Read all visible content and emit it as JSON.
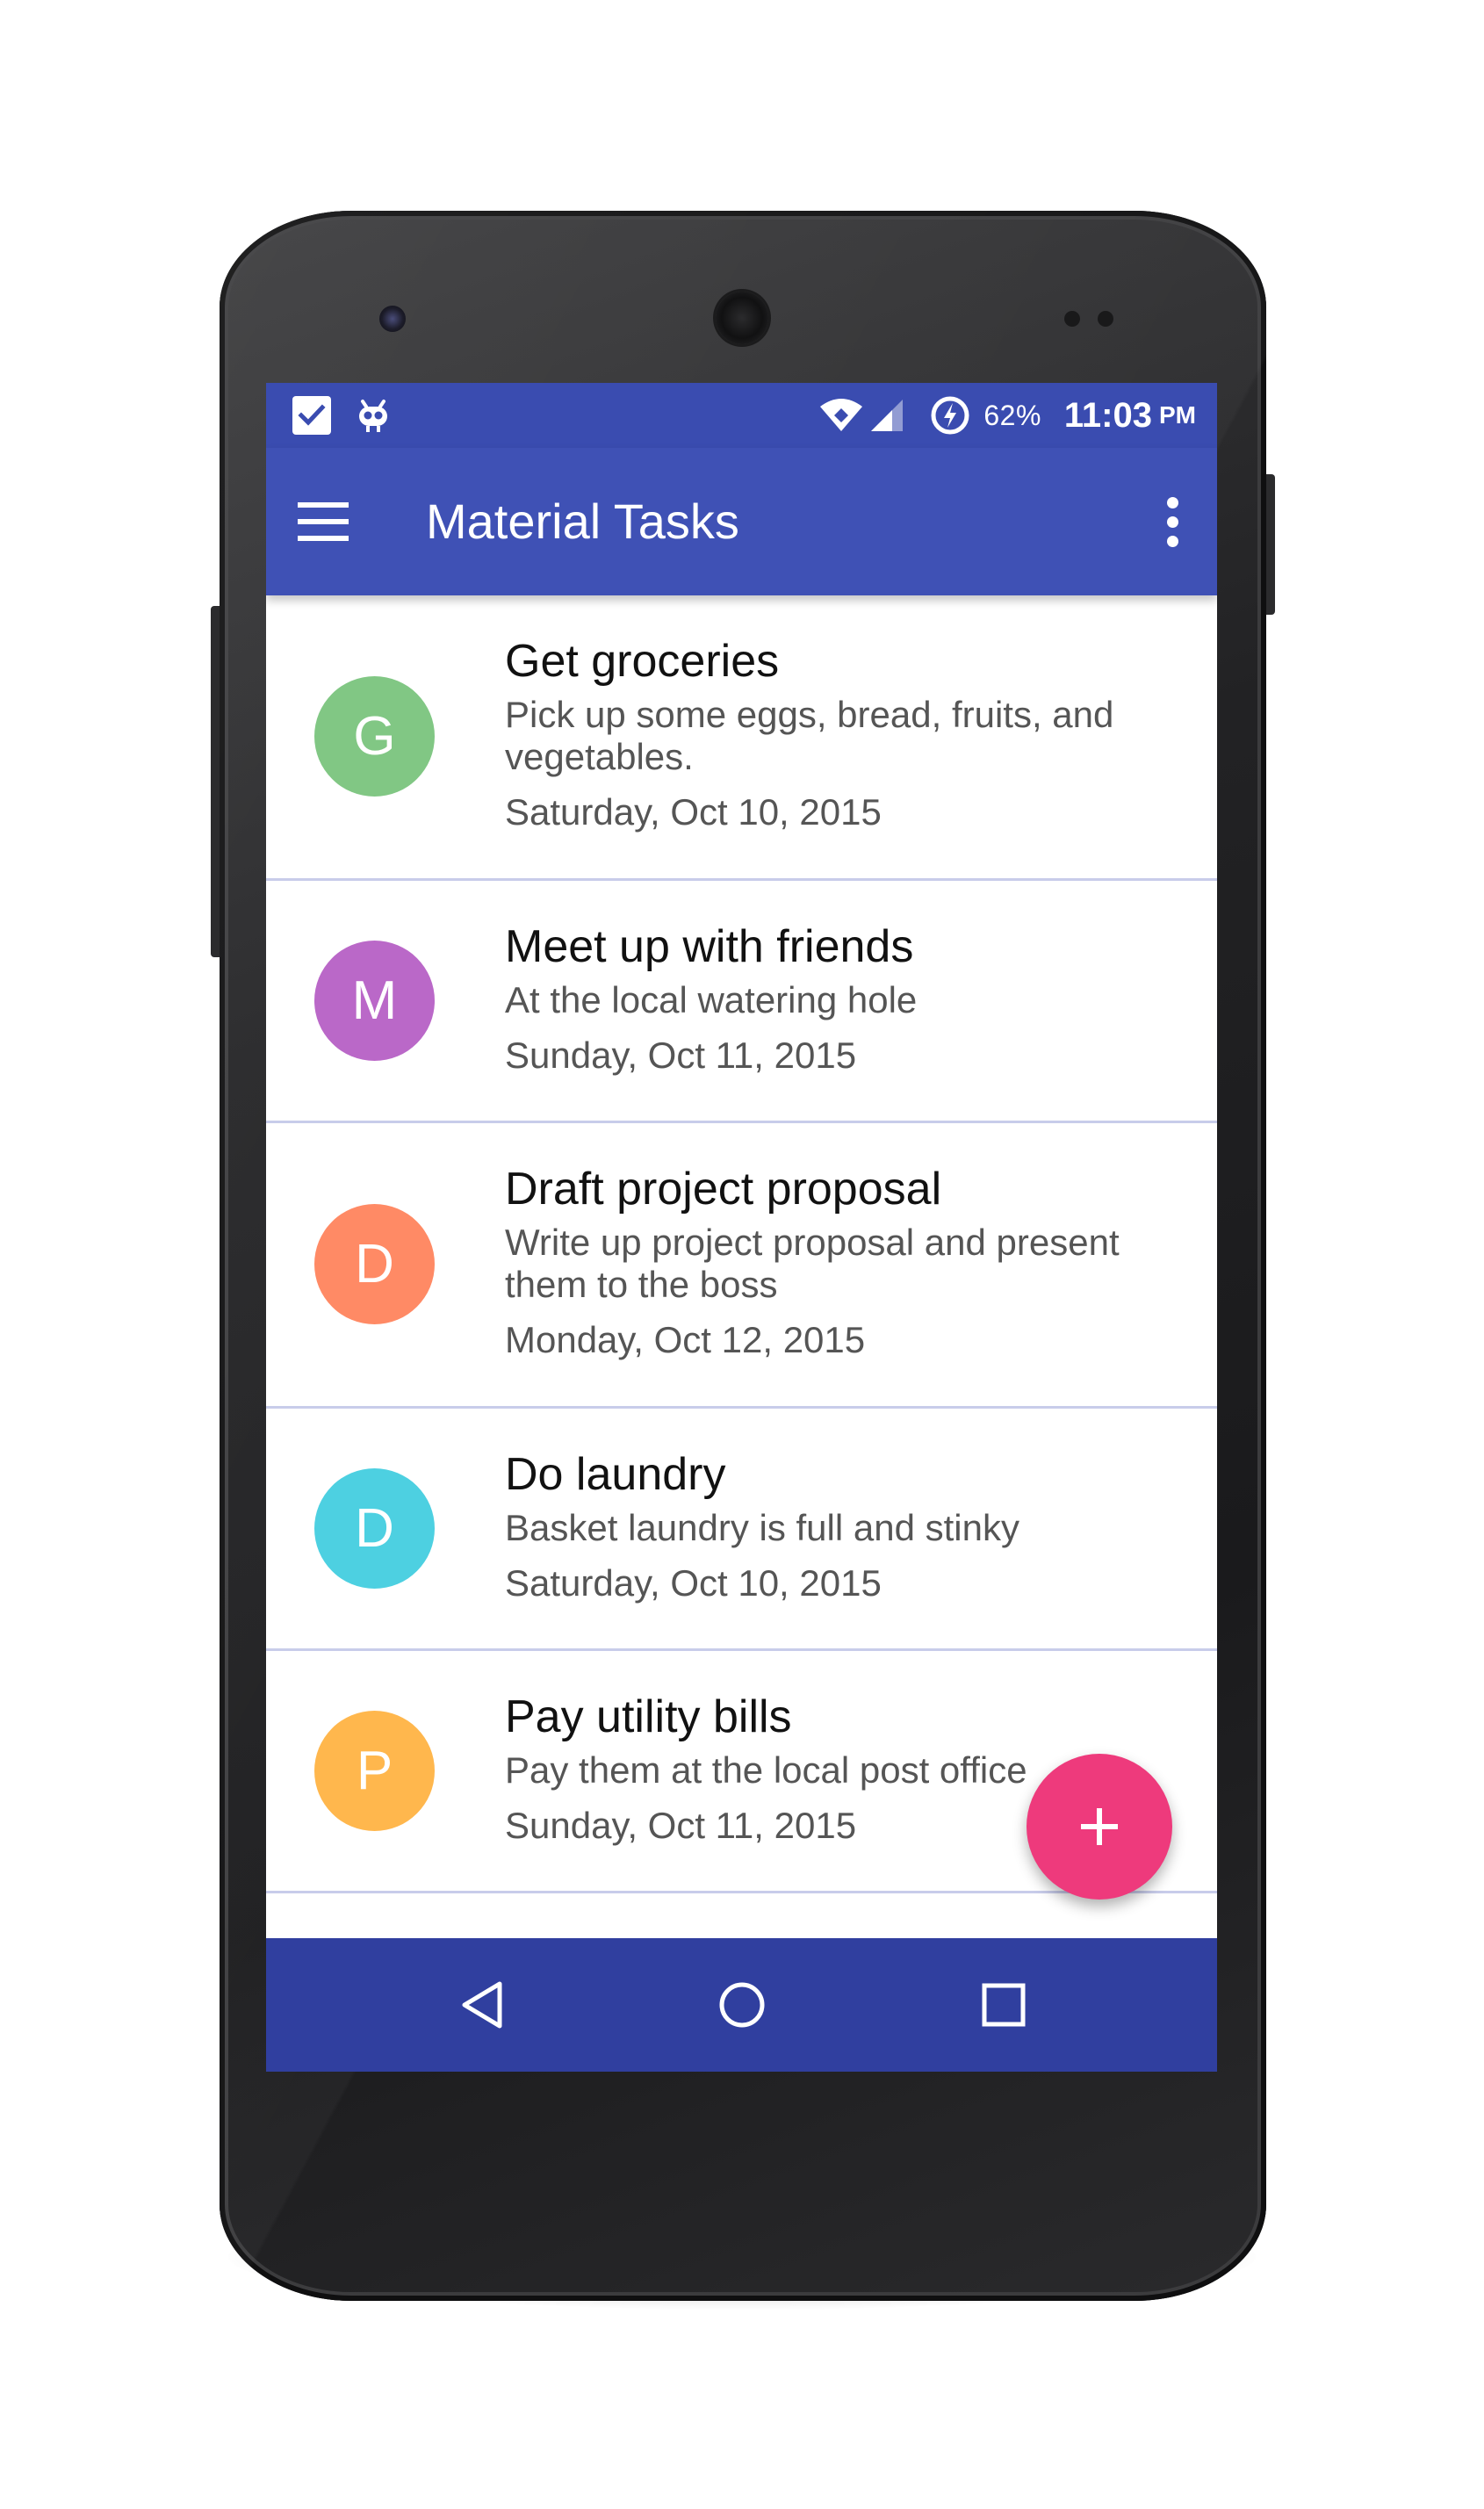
{
  "status_bar": {
    "battery_percent": "62%",
    "time": "11:03",
    "am_pm": "PM",
    "icons": [
      "task-check-icon",
      "cyanogen-icon",
      "wifi-icon",
      "cell-signal-icon",
      "battery-saver-icon"
    ]
  },
  "app_bar": {
    "title": "Material Tasks",
    "menu_icon": "hamburger-menu-icon",
    "overflow_icon": "more-vert-icon"
  },
  "tasks": [
    {
      "initial": "G",
      "title": "Get groceries",
      "description": "Pick up some eggs, bread, fruits, and vegetables.",
      "date": "Saturday, Oct 10, 2015",
      "color": "#81c784"
    },
    {
      "initial": "M",
      "title": "Meet up with friends",
      "description": "At the local watering hole",
      "date": "Sunday, Oct 11, 2015",
      "color": "#ba68c8"
    },
    {
      "initial": "D",
      "title": "Draft project proposal",
      "description": "Write up project proposal and present them to the boss",
      "date": "Monday, Oct 12, 2015",
      "color": "#ff8a65"
    },
    {
      "initial": "D",
      "title": "Do laundry",
      "description": "Basket laundry is full and stinky",
      "date": "Saturday, Oct 10, 2015",
      "color": "#4dd0e1"
    },
    {
      "initial": "P",
      "title": "Pay utility bills",
      "description": "Pay them at the local post office",
      "date": "Sunday, Oct 11, 2015",
      "color": "#ffb74d"
    }
  ],
  "fab": {
    "icon": "add-icon",
    "color": "#ee3a7c"
  },
  "nav_bar": {
    "buttons": [
      "back-icon",
      "home-icon",
      "recents-icon"
    ]
  },
  "colors": {
    "primary": "#3f51b5",
    "primary_dark": "#303f9f",
    "status_bar": "#3a4cb0",
    "divider": "#c8ccea"
  }
}
